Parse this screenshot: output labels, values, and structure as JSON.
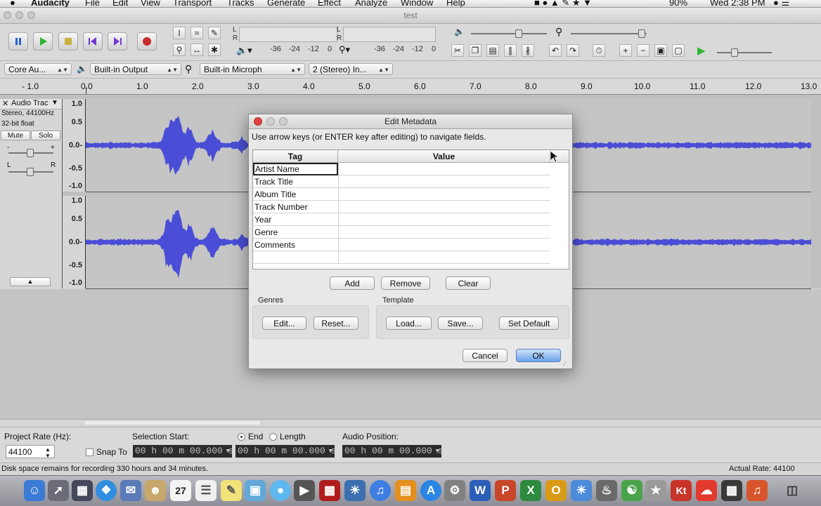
{
  "menubar": {
    "app": "Audacity",
    "items": [
      "File",
      "Edit",
      "View",
      "Transport",
      "Tracks",
      "Generate",
      "Effect",
      "Analyze",
      "Window",
      "Help"
    ],
    "battery": "90%",
    "clock": "Wed 2:38 PM"
  },
  "window": {
    "title": "test"
  },
  "meters": {
    "record_ticks": [
      "-36",
      "-24",
      "-12",
      "0"
    ],
    "play_ticks": [
      "-36",
      "-24",
      "-12",
      "0"
    ],
    "lr": [
      "L",
      "R"
    ],
    "lr2": [
      "L",
      "R"
    ]
  },
  "devices": {
    "host": "Core Au...",
    "output": "Built-in Output",
    "input": "Built-in Microph",
    "channels": "2 (Stereo) In..."
  },
  "ruler": {
    "ticks": [
      "- 1.0",
      "0.0",
      "1.0",
      "2.0",
      "3.0",
      "4.0",
      "5.0",
      "6.0",
      "7.0",
      "8.0",
      "9.0",
      "10.0",
      "11.0",
      "12.0",
      "13.0"
    ]
  },
  "track": {
    "name": "Audio Trac",
    "info1": "Stereo, 44100Hz",
    "info2": "32-bit float",
    "mute": "Mute",
    "solo": "Solo",
    "gain_marks": [
      "-",
      "+"
    ],
    "pan_marks": [
      "L",
      "R"
    ],
    "scale": [
      "1.0",
      "0.5",
      "0.0-",
      "-0.5",
      "-1.0"
    ],
    "scale2": [
      "1.0",
      "0.5",
      "0.0-",
      "-0.5",
      "-1.0"
    ],
    "wave_color": "#4a4ed6"
  },
  "dialog": {
    "title": "Edit Metadata",
    "instructions": "Use arrow keys (or ENTER key after editing) to navigate fields.",
    "col_tag": "Tag",
    "col_value": "Value",
    "rows": [
      {
        "tag": "Artist Name",
        "value": ""
      },
      {
        "tag": "Track Title",
        "value": ""
      },
      {
        "tag": "Album Title",
        "value": ""
      },
      {
        "tag": "Track Number",
        "value": ""
      },
      {
        "tag": "Year",
        "value": ""
      },
      {
        "tag": "Genre",
        "value": ""
      },
      {
        "tag": "Comments",
        "value": ""
      }
    ],
    "add": "Add",
    "remove": "Remove",
    "clear": "Clear",
    "genres_label": "Genres",
    "genres_edit": "Edit...",
    "genres_reset": "Reset...",
    "template_label": "Template",
    "template_load": "Load...",
    "template_save": "Save...",
    "template_default": "Set Default",
    "cancel": "Cancel",
    "ok": "OK"
  },
  "selection": {
    "project_rate_label": "Project Rate (Hz):",
    "project_rate": "44100",
    "snap_to": "Snap To",
    "selection_start_label": "Selection Start:",
    "end_label": "End",
    "length_label": "Length",
    "audio_position_label": "Audio Position:",
    "start": "00 h 00 m 00.000 s",
    "end": "00 h 00 m 00.000 s",
    "position": "00 h 00 m 00.000 s"
  },
  "status": {
    "left": "Disk space remains for recording 330 hours and 34 minutes.",
    "right": "Actual Rate: 44100"
  },
  "dock": {
    "calendar_day": "27",
    "letters": [
      "W",
      "P",
      "X",
      "O",
      "Kt"
    ]
  }
}
